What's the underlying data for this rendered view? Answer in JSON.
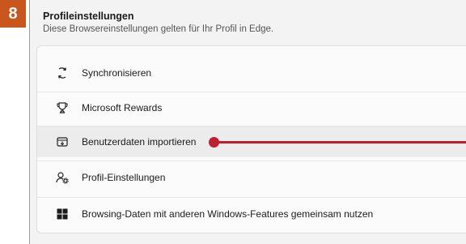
{
  "step": {
    "number": "8"
  },
  "section": {
    "title": "Profileinstellungen",
    "subtitle": "Diese Browsereinstellungen gelten für Ihr Profil in Edge."
  },
  "items": [
    {
      "label": "Synchronisieren",
      "icon": "sync-icon"
    },
    {
      "label": "Microsoft Rewards",
      "icon": "trophy-icon"
    },
    {
      "label": "Benutzerdaten importieren",
      "icon": "import-icon",
      "highlighted": true
    },
    {
      "label": "Profil-Einstellungen",
      "icon": "profile-settings-icon"
    },
    {
      "label": "Browsing-Daten mit anderen Windows-Features gemeinsam nutzen",
      "icon": "windows-icon"
    }
  ],
  "colors": {
    "badge": "#c8561d",
    "pointer": "#c01f2f",
    "highlight_row": "#ececec"
  }
}
